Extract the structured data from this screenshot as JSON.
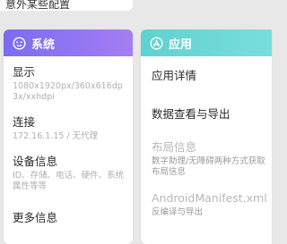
{
  "top": {
    "text": "意外某些配置"
  },
  "system_card": {
    "title": "系统",
    "icon": "robot-face-icon",
    "color_from": "#7a6cf0",
    "color_to": "#a47ef2",
    "items": [
      {
        "title": "显示",
        "subtitle": "1080x1920px/360x616dp 3x/xxhdpi"
      },
      {
        "title": "连接",
        "subtitle": "172.16.1.15 / 无代理"
      },
      {
        "title": "设备信息",
        "subtitle": "ID、存储、电话、硬件、系统属性等等"
      },
      {
        "title": "更多信息",
        "subtitle": ""
      }
    ]
  },
  "app_card": {
    "title": "应用",
    "icon": "app-store-icon",
    "color_from": "#5fd2cf",
    "color_to": "#79dedd",
    "items": [
      {
        "title": "应用详情",
        "subtitle": ""
      },
      {
        "title": "数据查看与导出",
        "subtitle": ""
      },
      {
        "title": "布局信息",
        "subtitle": "数字助理/无障碍两种方式获取布局信息",
        "disabled": true
      },
      {
        "title": "AndroidManifest.xml",
        "subtitle": "反编译与导出",
        "disabled": true
      }
    ]
  }
}
